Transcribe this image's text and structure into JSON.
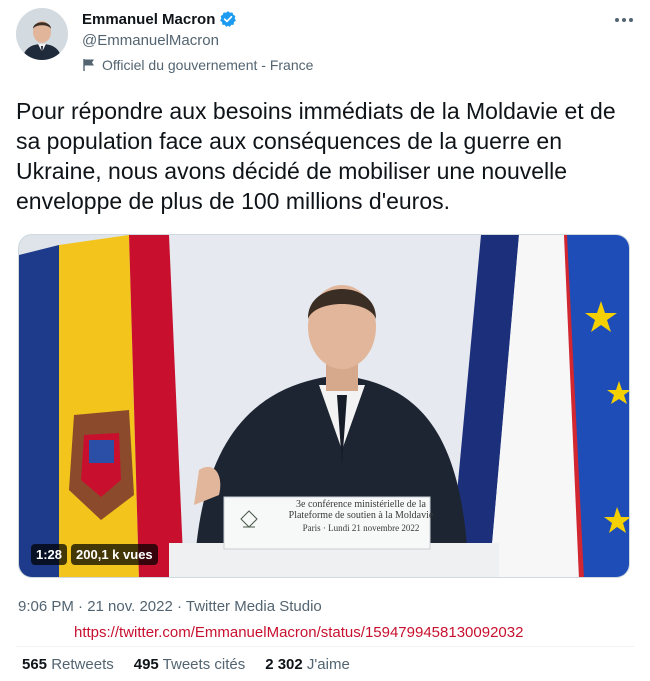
{
  "author": {
    "display_name": "Emmanuel Macron",
    "handle": "@EmmanuelMacron",
    "label": "Officiel du gouvernement - France"
  },
  "tweet": {
    "text": "Pour répondre aux besoins immédiats de la Moldavie et de sa population face aux conséquences de la guerre en Ukraine, nous avons décidé de mobiliser une nouvelle enveloppe de plus de 100 millions d'euros."
  },
  "video": {
    "duration": "1:28",
    "views": "200,1 k vues",
    "podium_line1": "3e conférence ministérielle de la",
    "podium_line2": "Plateforme de soutien à la Moldavie",
    "podium_line3": "Paris · Lundi 21 novembre 2022"
  },
  "meta": {
    "time": "9:06 PM",
    "date": "21 nov. 2022",
    "source": "Twitter Media Studio",
    "line": "9:06 PM · 21 nov. 2022 · Twitter Media Studio"
  },
  "overlay_url": "https://twitter.com/EmmanuelMacron/status/1594799458130092032",
  "stats": {
    "retweets_count": "565",
    "retweets_label": "Retweets",
    "quotes_count": "495",
    "quotes_label": "Tweets cités",
    "likes_count": "2 302",
    "likes_label": "J'aime"
  },
  "icons": {
    "verified": "verified-badge-icon",
    "government": "flag-icon",
    "more": "more-options-icon"
  },
  "colors": {
    "verified": "#1d9bf0",
    "text": "#0f1419",
    "secondary": "#536471",
    "overlay_url": "#c8102e"
  }
}
